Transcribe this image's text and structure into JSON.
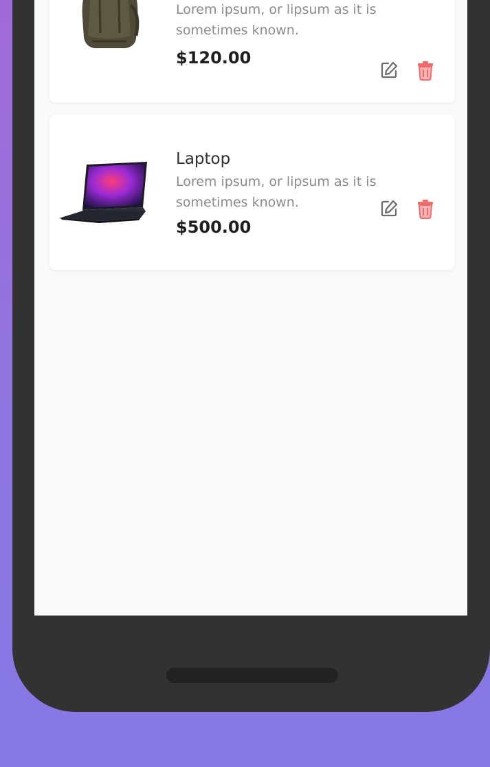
{
  "products": [
    {
      "title": "",
      "description": "Lorem ipsum, or lipsum as it is sometimes known.",
      "price": "$120.00",
      "image_icon": "backpack-image"
    },
    {
      "title": "Laptop",
      "description": "Lorem ipsum, or lipsum as it is sometimes known.",
      "price": "$500.00",
      "image_icon": "laptop-image"
    }
  ],
  "actions": {
    "edit_icon": "edit-icon",
    "delete_icon": "trash-icon"
  },
  "colors": {
    "delete_accent": "#f26b6b",
    "edit_gray": "#6b6b6b",
    "background_top": "#a06ad6",
    "background_bottom": "#8679e6",
    "device_frame": "#323232"
  }
}
